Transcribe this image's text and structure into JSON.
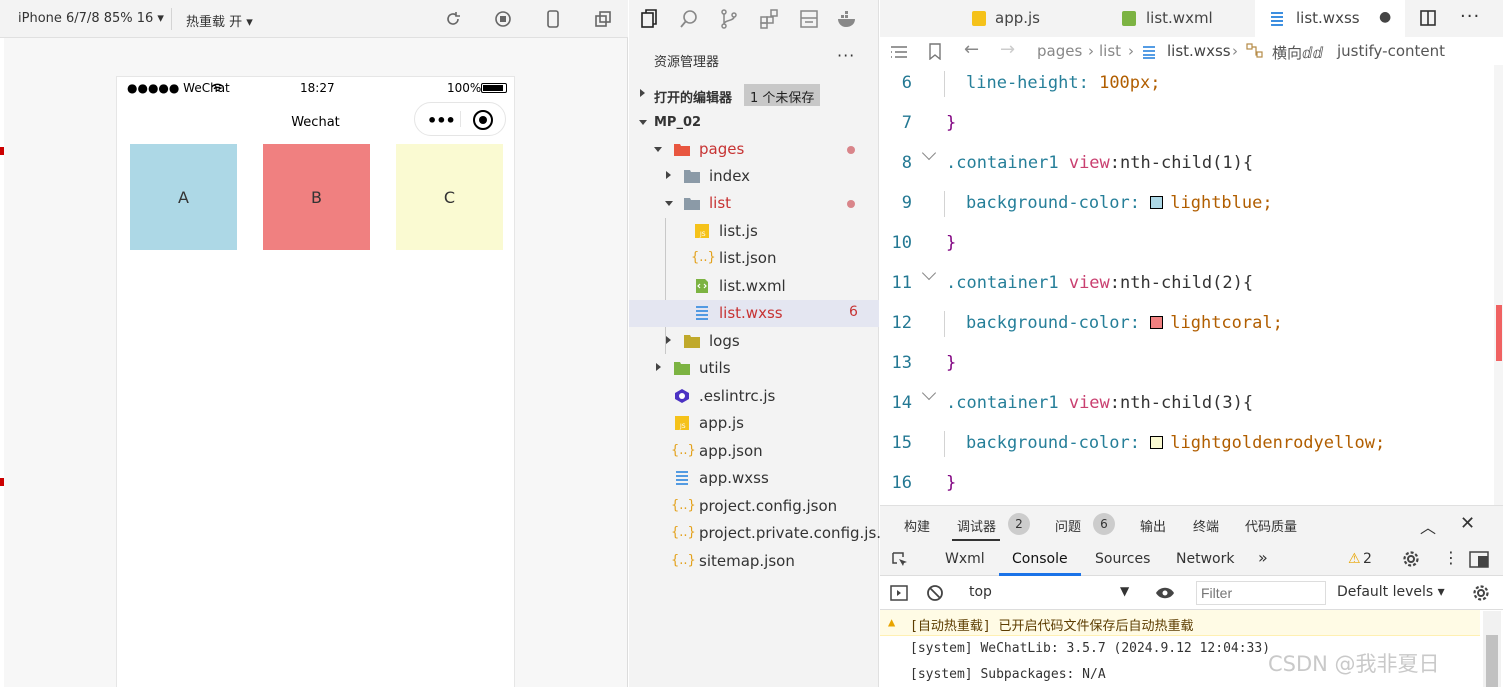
{
  "simulator": {
    "device": "iPhone 6/7/8 85% 16 ▾",
    "hot_reload": "热重载 开 ▾",
    "status": {
      "signal": "●●●●● WeChat",
      "time": "18:27",
      "battery": "100%"
    },
    "nav_title": "Wechat",
    "capsule_dots": "•••",
    "boxes": [
      {
        "label": "A",
        "color": "#add8e6"
      },
      {
        "label": "B",
        "color": "#f08080"
      },
      {
        "label": "C",
        "color": "#fafad2"
      }
    ]
  },
  "explorer": {
    "title": "资源管理器",
    "more": "···",
    "open_editors": "打开的编辑器",
    "unsaved_badge": "1 个未保存",
    "project": "MP_02",
    "items": [
      {
        "label": "pages",
        "type": "folder-open",
        "color": "#e8563f"
      },
      {
        "label": "index",
        "type": "folder"
      },
      {
        "label": "list",
        "type": "folder-open"
      },
      {
        "label": "list.js",
        "type": "js"
      },
      {
        "label": "list.json",
        "type": "json"
      },
      {
        "label": "list.wxml",
        "type": "wxml"
      },
      {
        "label": "list.wxss",
        "type": "wxss",
        "badge": "6"
      },
      {
        "label": "logs",
        "type": "folder"
      },
      {
        "label": "utils",
        "type": "folder"
      },
      {
        "label": ".eslintrc.js",
        "type": "eslint"
      },
      {
        "label": "app.js",
        "type": "js"
      },
      {
        "label": "app.json",
        "type": "json"
      },
      {
        "label": "app.wxss",
        "type": "wxss"
      },
      {
        "label": "project.config.json",
        "type": "json"
      },
      {
        "label": "project.private.config.js...",
        "type": "json"
      },
      {
        "label": "sitemap.json",
        "type": "json"
      }
    ]
  },
  "editor": {
    "tabs": [
      {
        "label": "app.js"
      },
      {
        "label": "list.wxml"
      },
      {
        "label": "list.wxss",
        "active": true,
        "modified": "●"
      }
    ],
    "breadcrumb": [
      "pages",
      "list",
      "list.wxss",
      "横向ⅆⅆ",
      "justify-content"
    ],
    "lines": [
      {
        "n": "6",
        "prop": "line-height:",
        "val": "100px;"
      },
      {
        "n": "7",
        "text": "}"
      },
      {
        "n": "8",
        "sel": ".container1",
        "pseudo": " view",
        "rest": ":nth-child(1){"
      },
      {
        "n": "9",
        "prop": "background-color:",
        "swatch": "#add8e6",
        "val": "lightblue;"
      },
      {
        "n": "10",
        "text": "}"
      },
      {
        "n": "11",
        "sel": ".container1",
        "pseudo": " view",
        "rest": ":nth-child(2){"
      },
      {
        "n": "12",
        "prop": "background-color:",
        "swatch": "#f08080",
        "val": "lightcoral;"
      },
      {
        "n": "13",
        "text": "}"
      },
      {
        "n": "14",
        "sel": ".container1",
        "pseudo": " view",
        "rest": ":nth-child(3){"
      },
      {
        "n": "15",
        "prop": "background-color:",
        "swatch": "#fafad2",
        "val": "lightgoldenrodyellow;"
      },
      {
        "n": "16",
        "text": "}"
      }
    ]
  },
  "panel": {
    "tabs": [
      "构建",
      "调试器",
      "问题",
      "输出",
      "终端",
      "代码质量"
    ],
    "debugger_badge": "2",
    "problems_badge": "6",
    "dev_tabs": [
      "Wxml",
      "Console",
      "Sources",
      "Network",
      "»"
    ],
    "warn_count": "2",
    "context": "top",
    "filter_placeholder": "Filter",
    "levels": "Default levels ▾",
    "logs": [
      {
        "text": "[自动热重载] 已开启代码文件保存后自动热重载",
        "level": "warn"
      },
      {
        "text": "[system] WeChatLib: 3.5.7 (2024.9.12 12:04:33)",
        "level": "info"
      },
      {
        "text": "[system] Subpackages: N/A",
        "level": "info"
      }
    ]
  },
  "watermark": "CSDN @我非夏日"
}
